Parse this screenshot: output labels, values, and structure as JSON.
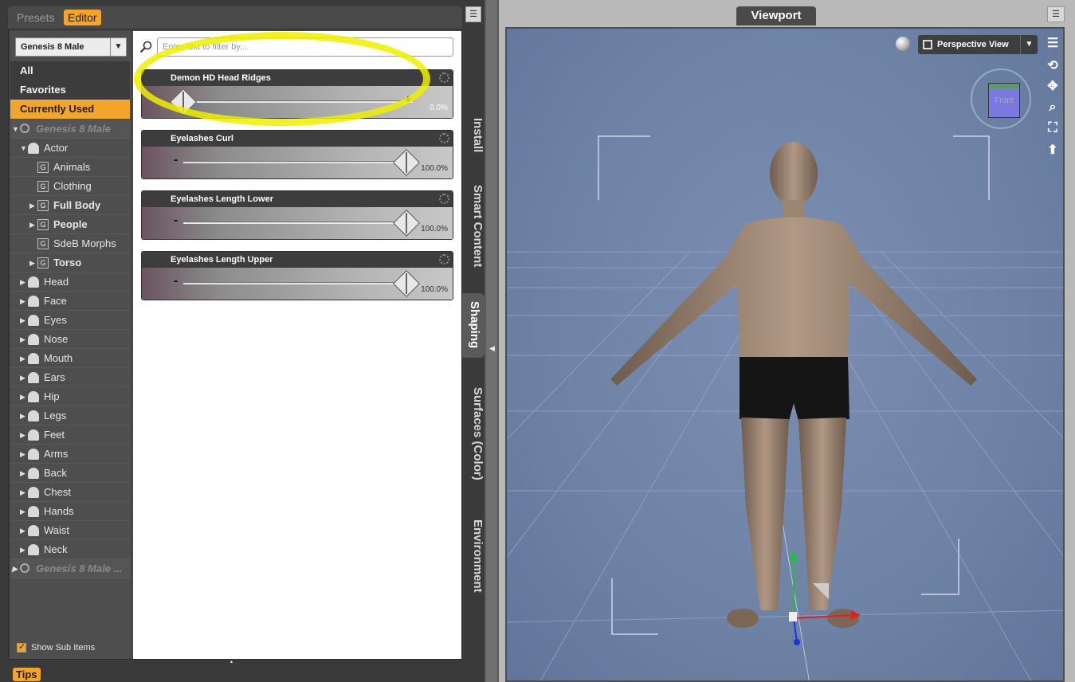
{
  "left_panel": {
    "tabs": [
      "Presets",
      "Editor"
    ],
    "active_tab": "Editor",
    "figure_select": "Genesis 8 Male",
    "quick_filters": [
      "All",
      "Favorites",
      "Currently Used"
    ],
    "active_filter": "Currently Used",
    "tree": [
      {
        "label": "Genesis 8 Male",
        "kind": "figure",
        "expanded": true
      },
      {
        "label": "Actor",
        "kind": "person",
        "expanded": true
      },
      {
        "label": "Animals",
        "kind": "group"
      },
      {
        "label": "Clothing",
        "kind": "group"
      },
      {
        "label": "Full Body",
        "kind": "group",
        "collapsed": true
      },
      {
        "label": "People",
        "kind": "group",
        "collapsed": true
      },
      {
        "label": "SdeB Morphs",
        "kind": "group"
      },
      {
        "label": "Torso",
        "kind": "group",
        "collapsed": true
      },
      {
        "label": "Head",
        "kind": "person",
        "collapsed": true
      },
      {
        "label": "Face",
        "kind": "person",
        "collapsed": true
      },
      {
        "label": "Eyes",
        "kind": "person",
        "collapsed": true
      },
      {
        "label": "Nose",
        "kind": "person",
        "collapsed": true
      },
      {
        "label": "Mouth",
        "kind": "person",
        "collapsed": true
      },
      {
        "label": "Ears",
        "kind": "person",
        "collapsed": true
      },
      {
        "label": "Hip",
        "kind": "person",
        "collapsed": true
      },
      {
        "label": "Legs",
        "kind": "person",
        "collapsed": true
      },
      {
        "label": "Feet",
        "kind": "person",
        "collapsed": true
      },
      {
        "label": "Arms",
        "kind": "person",
        "collapsed": true
      },
      {
        "label": "Back",
        "kind": "person",
        "collapsed": true
      },
      {
        "label": "Chest",
        "kind": "person",
        "collapsed": true
      },
      {
        "label": "Hands",
        "kind": "person",
        "collapsed": true
      },
      {
        "label": "Waist",
        "kind": "person",
        "collapsed": true
      },
      {
        "label": "Neck",
        "kind": "person",
        "collapsed": true
      },
      {
        "label": "Genesis 8 Male ...",
        "kind": "figure",
        "collapsed": true
      }
    ],
    "show_sub_items": "Show Sub Items",
    "filter_placeholder": "Enter text to filter by...",
    "sliders": [
      {
        "name": "Demon HD Head Ridges",
        "value": "0.0%",
        "fraction": 0.0
      },
      {
        "name": "Eyelashes Curl",
        "value": "100.0%",
        "fraction": 1.0
      },
      {
        "name": "Eyelashes Length Lower",
        "value": "100.0%",
        "fraction": 1.0
      },
      {
        "name": "Eyelashes Length Upper",
        "value": "100.0%",
        "fraction": 1.0
      }
    ],
    "side_tabs": [
      "Install",
      "Smart Content",
      "Shaping",
      "Surfaces (Color)",
      "Environment"
    ],
    "active_side_tab": "Shaping",
    "tips": "Tips"
  },
  "viewport": {
    "title": "Viewport",
    "camera": "Perspective View",
    "cube_label": "Front"
  },
  "colors": {
    "accent": "#f3a52b",
    "viewport_bg": "#6e82a6",
    "highlight": "#eeee00"
  }
}
